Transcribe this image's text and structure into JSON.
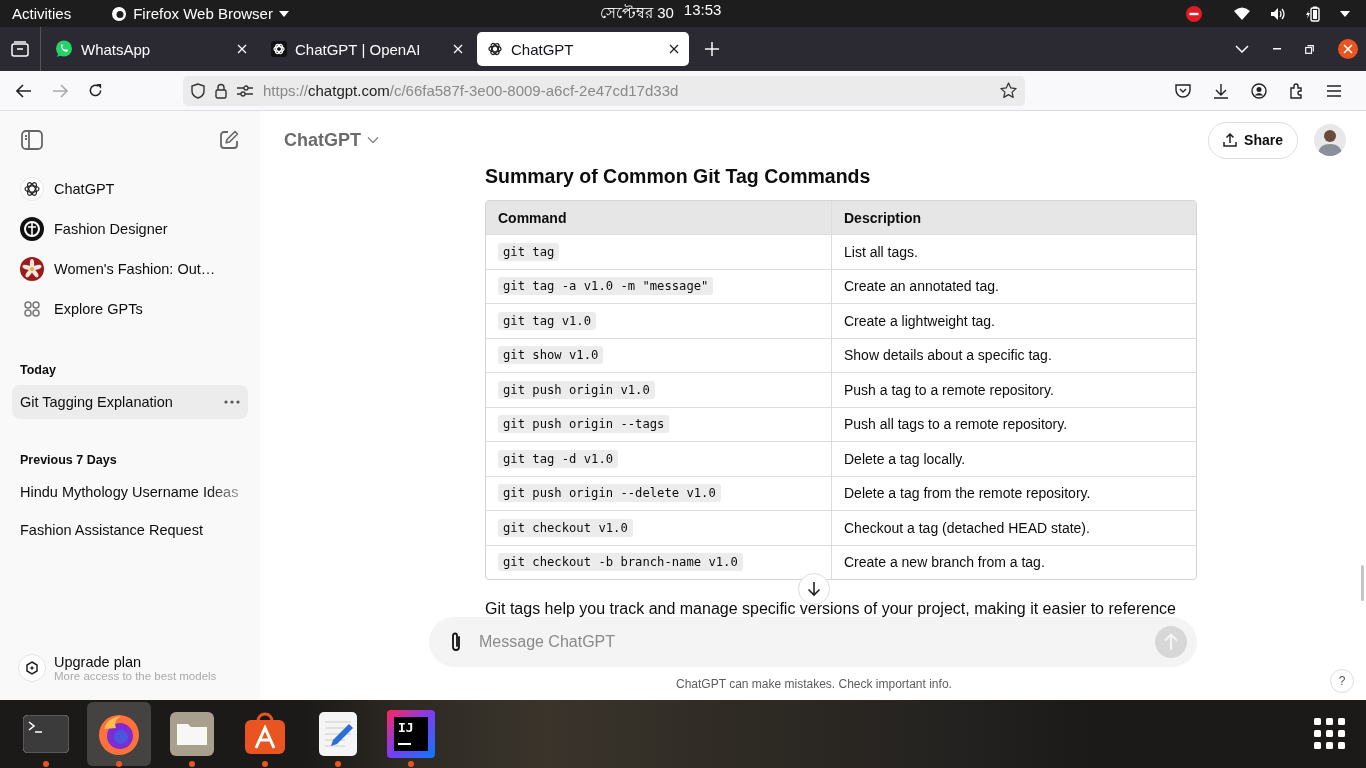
{
  "top_bar": {
    "activities": "Activities",
    "app_name": "Firefox Web Browser",
    "date": "সেপ্টেম্বর 30",
    "time": "13:53"
  },
  "browser_tabs": [
    {
      "title": "WhatsApp",
      "kind": "whatsapp",
      "selected": false
    },
    {
      "title": "ChatGPT | OpenAI",
      "kind": "openai-dark",
      "selected": false
    },
    {
      "title": "ChatGPT",
      "kind": "openai",
      "selected": true
    }
  ],
  "url": {
    "scheme": "https://",
    "host": "chatgpt.com",
    "path": "/c/66fa587f-3e00-8009-a6cf-2e47cd17d33d"
  },
  "sidebar": {
    "gpts": [
      {
        "label": "ChatGPT",
        "kind": "openai"
      },
      {
        "label": "Fashion Designer",
        "kind": "dark-logo"
      },
      {
        "label": "Women's Fashion: Out…",
        "kind": "flower"
      },
      {
        "label": "Explore GPTs",
        "kind": "grid"
      }
    ],
    "sections": [
      {
        "heading": "Today",
        "items": [
          {
            "label": "Git Tagging Explanation",
            "selected": true
          }
        ]
      },
      {
        "heading": "Previous 7 Days",
        "items": [
          {
            "label": "Hindu Mythology Username Ideas",
            "selected": false
          },
          {
            "label": "Fashion Assistance Request",
            "selected": false
          }
        ]
      }
    ],
    "upgrade": {
      "title": "Upgrade plan",
      "subtitle": "More access to the best models"
    }
  },
  "header": {
    "model": "ChatGPT",
    "share": "Share"
  },
  "content": {
    "heading": "Summary of Common Git Tag Commands",
    "table": {
      "columns": [
        "Command",
        "Description"
      ],
      "rows": [
        [
          "git tag",
          "List all tags."
        ],
        [
          "git tag -a v1.0 -m \"message\"",
          "Create an annotated tag."
        ],
        [
          "git tag v1.0",
          "Create a lightweight tag."
        ],
        [
          "git show v1.0",
          "Show details about a specific tag."
        ],
        [
          "git push origin v1.0",
          "Push a tag to a remote repository."
        ],
        [
          "git push origin --tags",
          "Push all tags to a remote repository."
        ],
        [
          "git tag -d v1.0",
          "Delete a tag locally."
        ],
        [
          "git push origin --delete v1.0",
          "Delete a tag from the remote repository."
        ],
        [
          "git checkout v1.0",
          "Checkout a tag (detached HEAD state)."
        ],
        [
          "git checkout -b branch-name v1.0",
          "Create a new branch from a tag."
        ]
      ]
    },
    "paragraph": "Git tags help you track and manage specific versions of your project, making it easier to reference"
  },
  "composer": {
    "placeholder": "Message ChatGPT"
  },
  "footer": {
    "note": "ChatGPT can make mistakes. Check important info.",
    "help": "?"
  },
  "dock": [
    {
      "kind": "terminal",
      "running": true,
      "selected": false
    },
    {
      "kind": "firefox",
      "running": true,
      "selected": true
    },
    {
      "kind": "files",
      "running": true,
      "selected": false
    },
    {
      "kind": "store",
      "running": true,
      "selected": false
    },
    {
      "kind": "editor",
      "running": true,
      "selected": false
    },
    {
      "kind": "ide",
      "label": "IJ",
      "running": true,
      "selected": false
    }
  ]
}
